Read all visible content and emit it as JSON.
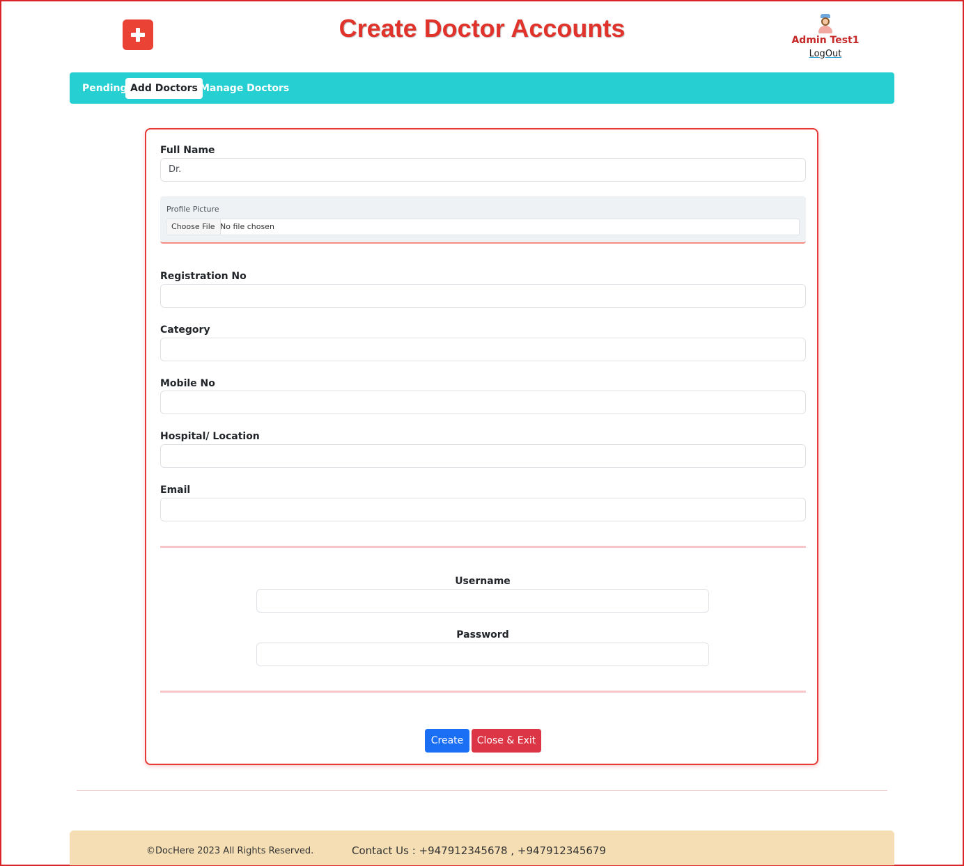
{
  "header": {
    "title": "Create Doctor Accounts",
    "logo_icon": "medical-kit-icon",
    "user": {
      "avatar_icon": "nurse-avatar-icon",
      "name": "Admin Test1",
      "logout_label": "LogOut"
    }
  },
  "nav": {
    "items": [
      {
        "label": "Pending",
        "active": false
      },
      {
        "label": "Add Doctors",
        "active": true
      },
      {
        "label": "Manage Doctors",
        "active": false
      }
    ],
    "color": "#26cfd2"
  },
  "form": {
    "full_name": {
      "label": "Full Name",
      "value": "Dr."
    },
    "profile_picture": {
      "label": "Profile Picture",
      "button_label": "Choose File",
      "status": "No file chosen"
    },
    "registration_no": {
      "label": "Registration No",
      "value": ""
    },
    "category": {
      "label": "Category",
      "value": ""
    },
    "mobile_no": {
      "label": "Mobile No",
      "value": ""
    },
    "hospital_location": {
      "label": "Hospital/ Location",
      "value": ""
    },
    "email": {
      "label": "Email",
      "value": ""
    },
    "username": {
      "label": "Username",
      "value": ""
    },
    "password": {
      "label": "Password",
      "value": ""
    },
    "create_label": "Create",
    "close_label": "Close & Exit"
  },
  "footer": {
    "copyright": "©DocHere 2023 All Rights Reserved.",
    "contact": "Contact Us : +947912345678 , +947912345679"
  },
  "colors": {
    "accent": "#e0332b",
    "create_button": "#1a6ff5",
    "close_button": "#dc3545",
    "footer_bg": "#f5deb3"
  }
}
